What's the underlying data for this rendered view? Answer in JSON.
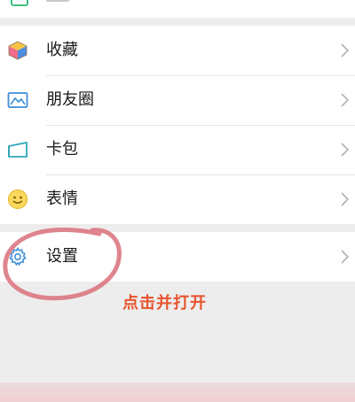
{
  "menu": {
    "items": [
      {
        "label": "收藏"
      },
      {
        "label": "朋友圈"
      },
      {
        "label": "卡包"
      },
      {
        "label": "表情"
      }
    ],
    "settings": {
      "label": "设置"
    }
  },
  "annotation": {
    "instruction": "点击并打开",
    "text_color": "#e8542d",
    "circle_color": "#d9707a"
  }
}
